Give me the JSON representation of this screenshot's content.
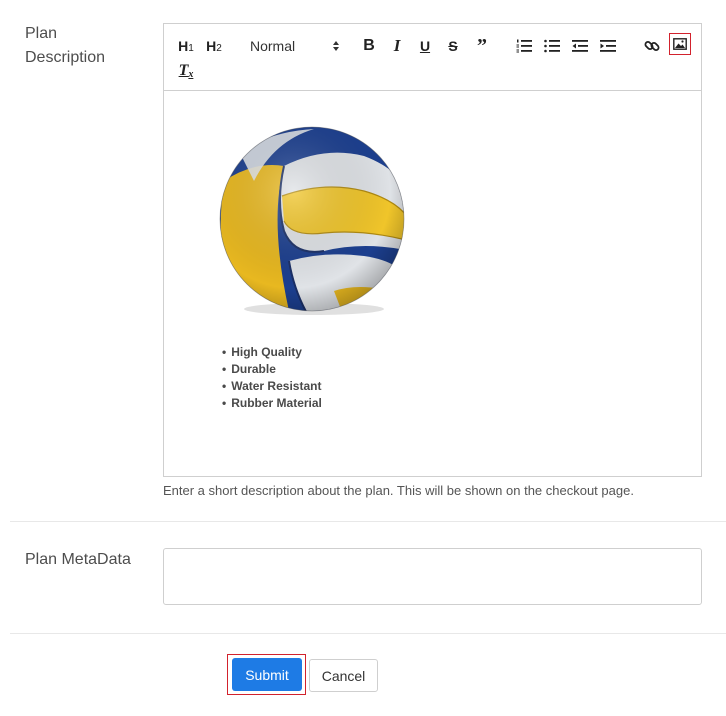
{
  "form": {
    "plan_description_label": "Plan Description",
    "plan_metadata_label": "Plan MetaData",
    "help_text": "Enter a short description about the plan. This will be shown on the checkout page.",
    "metadata_value": ""
  },
  "toolbar": {
    "h1": "H",
    "h1_sub": "1",
    "h2": "H",
    "h2_sub": "2",
    "format_select": "Normal",
    "bold": "B",
    "italic": "I",
    "underline": "U",
    "strike": "S",
    "quote": "”",
    "clear_format": "T",
    "clear_format_sub": "x"
  },
  "editor": {
    "image_name": "volleyball",
    "bullets": [
      "High Quality",
      "Durable",
      "Water Resistant",
      "Rubber  Material"
    ]
  },
  "buttons": {
    "submit": "Submit",
    "cancel": "Cancel"
  },
  "colors": {
    "accent": "#1e7be5",
    "highlight": "#d2222d"
  }
}
